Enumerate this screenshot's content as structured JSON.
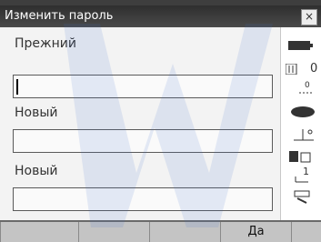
{
  "window": {
    "title": "Изменить пароль",
    "close_label": "×"
  },
  "form": {
    "old_password_label": "Прежний",
    "old_password_value": "",
    "new_password_label": "Новый",
    "new_password_value": "",
    "confirm_password_label": "Новый",
    "confirm_password_value": ""
  },
  "status_icons": [
    {
      "name": "battery-icon",
      "text": ""
    },
    {
      "name": "signal-icon",
      "text": "0"
    },
    {
      "name": "prism-constant-icon",
      "text": "0"
    },
    {
      "name": "target-icon",
      "text": ""
    },
    {
      "name": "tilt-icon",
      "text": ""
    },
    {
      "name": "memory-icon",
      "text": ""
    },
    {
      "name": "face-icon",
      "text": "1"
    },
    {
      "name": "keyboard-icon",
      "text": ""
    }
  ],
  "softkeys": [
    "",
    "",
    "",
    "Да",
    ""
  ]
}
